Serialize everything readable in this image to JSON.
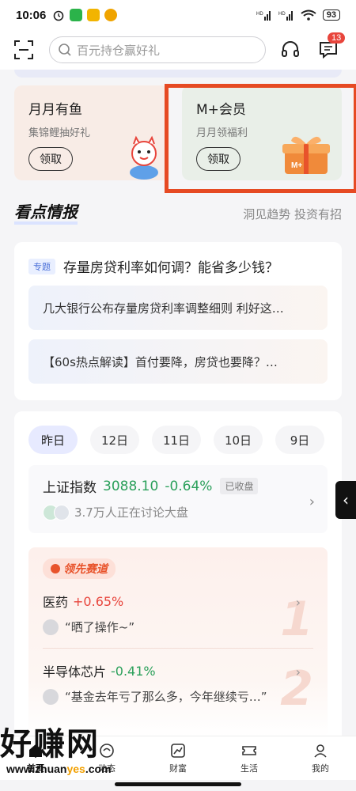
{
  "status": {
    "time": "10:06",
    "network1": "HD 5G",
    "network2": "HD 5G",
    "battery": "93"
  },
  "top_nav": {
    "search_placeholder": "百元持仓赢好礼",
    "message_count": "13"
  },
  "promos": [
    {
      "title": "月月有鱼",
      "subtitle": "集锦鲤抽好礼",
      "button": "领取"
    },
    {
      "title": "M+会员",
      "subtitle": "月月领福利",
      "button": "领取"
    }
  ],
  "news_section": {
    "title": "看点情报",
    "subtitle": "洞见趋势 投资有招",
    "topic_tag": "专题",
    "topic_title": "存量房贷利率如何调？能省多少钱？",
    "items": [
      "几大银行公布存量房贷利率调整细则 利好这…",
      "【60s热点解读】首付要降，房贷也要降？…"
    ]
  },
  "market": {
    "date_tabs": [
      "昨日",
      "12日",
      "11日",
      "10日",
      "9日"
    ],
    "index": {
      "name": "上证指数",
      "value": "3088.10",
      "change": "-0.64%",
      "status": "已收盘",
      "discussion": "3.7万人正在讨论大盘"
    },
    "lead_tag": "领先赛道",
    "sectors": [
      {
        "name": "医药",
        "change": "+0.65%",
        "comment": "“晒了操作~”",
        "rank": "1"
      },
      {
        "name": "半导体芯片",
        "change": "-0.41%",
        "comment": "“基金去年亏了那么多，今年继续亏…”",
        "rank": "2"
      }
    ]
  },
  "bottom_nav": [
    {
      "label": "首页"
    },
    {
      "label": "动态"
    },
    {
      "label": "财富"
    },
    {
      "label": "生活"
    },
    {
      "label": "我的"
    }
  ],
  "watermark": {
    "main": "好赚网",
    "sub_left": "www.zhuan",
    "sub_o": "yes",
    "sub_right": ".com"
  }
}
